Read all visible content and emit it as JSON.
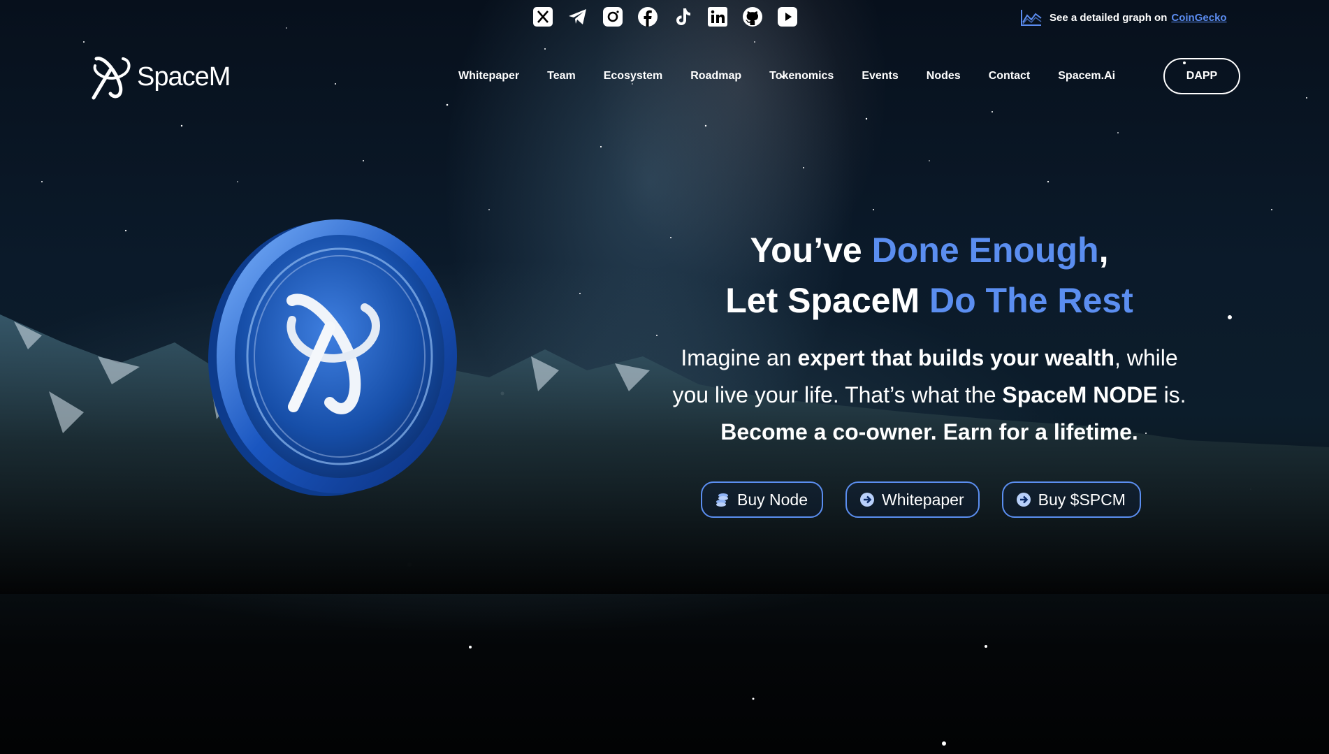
{
  "social_icons": [
    "x-icon",
    "telegram-icon",
    "instagram-icon",
    "facebook-icon",
    "tiktok-icon",
    "linkedin-icon",
    "github-icon",
    "youtube-icon"
  ],
  "graph_link": {
    "prefix": "See a detailed graph on",
    "link": "CoinGecko"
  },
  "brand": {
    "name": "SpaceM"
  },
  "nav": {
    "items": [
      "Whitepaper",
      "Team",
      "Ecosystem",
      "Roadmap",
      "Tokenomics",
      "Events",
      "Nodes",
      "Contact",
      "Spacem.Ai"
    ],
    "dapp": "DAPP"
  },
  "hero": {
    "line1_a": "You’ve ",
    "line1_b": "Done Enough",
    "line1_c": ",",
    "line2_a": "Let SpaceM ",
    "line2_b": "Do The Rest",
    "sub_1": "Imagine an ",
    "sub_2": "expert that builds your wealth",
    "sub_3": ", while",
    "sub_4": "you live your life. That’s what the ",
    "sub_5": "SpaceM NODE",
    "sub_6": " is.",
    "sub_7": "Become a co-owner. Earn for a lifetime."
  },
  "ctas": [
    {
      "label": "Buy Node",
      "icon": "coins-icon"
    },
    {
      "label": "Whitepaper",
      "icon": "arrow-circle-icon"
    },
    {
      "label": "Buy $SPCM",
      "icon": "arrow-circle-icon"
    }
  ],
  "colors": {
    "accent": "#5b8ef0",
    "link": "#5b8cf0",
    "background": "#07101c"
  }
}
